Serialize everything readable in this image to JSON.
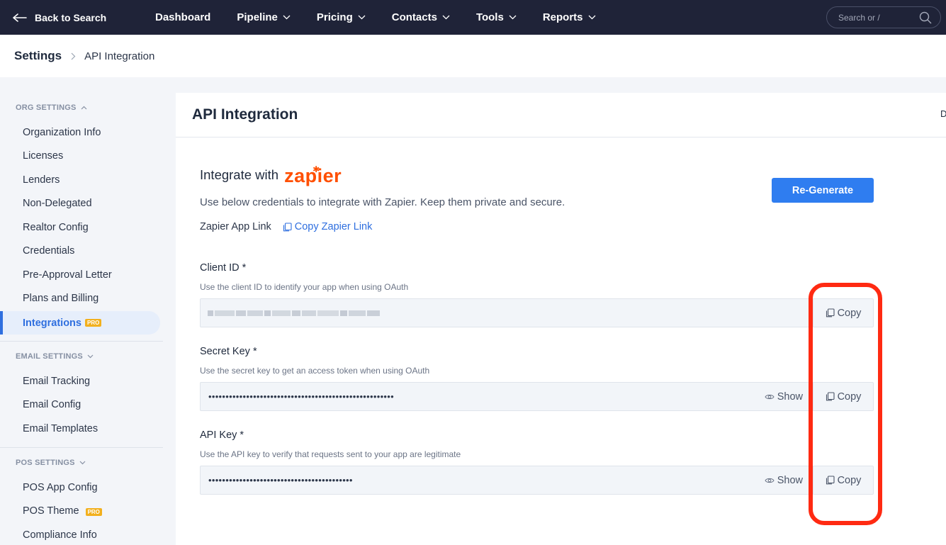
{
  "topnav": {
    "back_label": "Back to Search",
    "items": [
      {
        "label": "Dashboard",
        "has_chevron": false
      },
      {
        "label": "Pipeline",
        "has_chevron": true
      },
      {
        "label": "Pricing",
        "has_chevron": true
      },
      {
        "label": "Contacts",
        "has_chevron": true
      },
      {
        "label": "Tools",
        "has_chevron": true
      },
      {
        "label": "Reports",
        "has_chevron": true
      }
    ],
    "search_placeholder": "Search or /"
  },
  "breadcrumb": {
    "root": "Settings",
    "current": "API Integration"
  },
  "sidebar": {
    "org_settings": "ORG SETTINGS",
    "org_items": [
      "Organization Info",
      "Licenses",
      "Lenders",
      "Non-Delegated",
      "Realtor Config",
      "Credentials",
      "Pre-Approval Letter",
      "Plans and Billing"
    ],
    "active_item": "Integrations",
    "pro_badge": "PRO",
    "email_settings": "EMAIL SETTINGS",
    "email_items": [
      "Email Tracking",
      "Email Config",
      "Email Templates"
    ],
    "pos_settings": "POS SETTINGS",
    "pos_items": [
      "POS App Config",
      "POS Theme",
      "Compliance Info"
    ]
  },
  "panel": {
    "title": "API Integration",
    "edge_text": "D",
    "integrate_with": "Integrate with",
    "zapier_logo": "zapier",
    "description": "Use below credentials to integrate with Zapier. Keep them private and secure.",
    "app_link_label": "Zapier App Link",
    "copy_link_label": "Copy Zapier Link",
    "regenerate_label": "Re-Generate"
  },
  "fields": {
    "client_id": {
      "label": "Client ID *",
      "hint": "Use the client ID to identify your app when using OAuth",
      "value_redacted": true
    },
    "secret_key": {
      "label": "Secret Key *",
      "hint": "Use the secret key to get an access token when using OAuth",
      "value": "••••••••••••••••••••••••••••••••••••••••••••••••••••••"
    },
    "api_key": {
      "label": "API Key *",
      "hint": "Use the API key to verify that requests sent to your app are legitimate",
      "value": "••••••••••••••••••••••••••••••••••••••••••"
    },
    "show_label": "Show",
    "copy_label": "Copy"
  },
  "colors": {
    "nav_bg": "#1f2338",
    "accent_blue": "#2f7df0",
    "zapier_orange": "#ff4f00",
    "highlight_red": "#ff2a12",
    "pro_badge": "#f2b01e"
  }
}
